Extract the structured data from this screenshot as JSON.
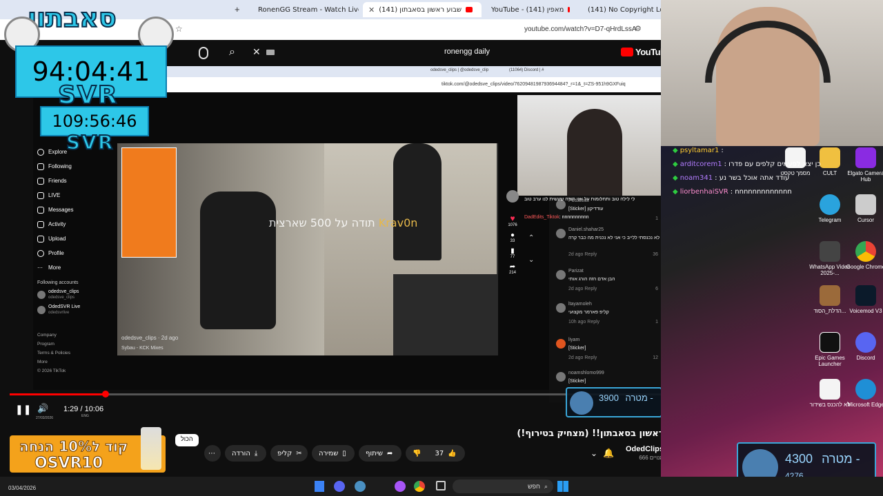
{
  "browser": {
    "tabs": [
      {
        "label": "RonenGG Stream - Watch Live"
      },
      {
        "label": "שבוע ראשון בסאבתון (141)"
      },
      {
        "label": "YouTube - מאפין (141)"
      },
      {
        "label": "(141) No Copyright Lo-Fi Mu"
      }
    ],
    "url": "youtube.com/watch?v=D7-qHrdLssA"
  },
  "youtube": {
    "search_value": "ronengg daily",
    "logo": "YouTube"
  },
  "inner_browser": {
    "tab_label": "odedsve_clips | @odedsve_clip",
    "tab2_label": "(11064) Discord | #",
    "url": "tiktok.com/@odedsve_clips/video/7620948198793694484?_r=1&_t=ZS-951h9GXFuiq"
  },
  "tiktok": {
    "nav": [
      "Explore",
      "Following",
      "Friends",
      "LIVE",
      "Messages",
      "Activity",
      "Upload",
      "Profile",
      "More"
    ],
    "following_title": "Following accounts",
    "accounts": [
      {
        "name": "odedsve_clips",
        "handle": "odedsve_clips"
      },
      {
        "name": "OdedSVR Live",
        "handle": "odedsvrlive"
      }
    ],
    "footer": [
      "Company",
      "Program",
      "Terms & Policies",
      "More",
      "© 2026 TikTok"
    ],
    "video_caption": "odedsve_clips · 2d ago",
    "music": "Sybau - KCK Mixes",
    "overlay_text": "תודה על 500 שארצית",
    "overlay_name": "Krav0n",
    "counts": [
      "1076",
      "33",
      "77",
      "214"
    ],
    "comments": [
      {
        "name": "PostBoss",
        "text": "[Sticker] עודדיקון",
        "meta": "",
        "likes": "1"
      },
      {
        "name": "Daniel.shahar25",
        "text": "אחי כולה היום לא נכנסתי ללייב כי אני לא נכנית מה כבר קרה",
        "meta": "2d ago",
        "likes": "36"
      },
      {
        "name": "Parizat",
        "text": "הבן אדם הזה הורג אותי",
        "meta": "2d ago",
        "likes": "6"
      },
      {
        "name": "ltayamoleh",
        "text": "קליפ פארמר מקצועי",
        "meta": "10h ago",
        "likes": "1"
      },
      {
        "name": "liyam",
        "text": "[Sticker]",
        "meta": "2d ago",
        "likes": "12"
      },
      {
        "name": "noamshlomo999",
        "text": "[Sticker]",
        "meta": "",
        "likes": ""
      }
    ],
    "reply": "Reply"
  },
  "player": {
    "time": "1:29 / 10:06",
    "progress": 0.147,
    "inner_date": "27/03/2026",
    "inner_lang": "ENG"
  },
  "video_meta": {
    "title": "שבוע ראשון בסאבתון!! (מצחיק בטירוף!)",
    "channel": "OdedClips",
    "subscribers": "666 מנויים",
    "likes": "37",
    "share": "שיתוף",
    "save": "שמירה",
    "clip": "קליפ",
    "download": "הורדה",
    "all_chip": "הכול"
  },
  "overlays": {
    "brand_title": "סאבתון",
    "timer1": "94:04:41",
    "timer2": "109:56:46",
    "svr": "SVR",
    "goal_small_value": "3900",
    "goal_small_label": "מטרה -",
    "goal_big_value": "4300",
    "goal_big_label": "מטרה -",
    "goal_big_sub": "4276",
    "promo_line1": "קוד ל10% הנחה",
    "promo_line2": "OSVR10"
  },
  "chat": [
    {
      "user": "psyltamar1",
      "text": ":",
      "color": "#ffcc33"
    },
    {
      "user": "arditcorem1",
      "text": ": כן יצא לפעמים קלפים עם פדרו",
      "color": "#b27cff"
    },
    {
      "user": "noam341",
      "text": ": עודד אתה אוכל בשר נע",
      "color": "#b27cff"
    },
    {
      "user": "liorbenhaiSVR",
      "text": ": nnnnnnnnnnnnn",
      "color": "#ff8fd0"
    },
    {
      "user": "DadEdits_Tiktok",
      "text": ": nnnnnnnnnn",
      "color": "#ff5a5a"
    }
  ],
  "stream_banner": "לי לילה טוב ותחלומות על אני תודה שעשית לנו ערב טוב",
  "desktop_icons": [
    {
      "label": "CULT",
      "color": "#f0c040"
    },
    {
      "label": "Elgato Camera Hub",
      "color": "#8a2be2"
    },
    {
      "label": "Telegram",
      "color": "#2aa3dd"
    },
    {
      "label": "Cursor",
      "color": "#cccccc"
    },
    {
      "label": "WhatsApp Video 2025-...",
      "color": "#444444"
    },
    {
      "label": "Google Chrome",
      "color": "#34a853"
    },
    {
      "label": "הדלת_הסוד...",
      "color": "#9b6a3a"
    },
    {
      "label": "Voicemod V3",
      "color": "#0b1a2a"
    },
    {
      "label": "Epic Games Launcher",
      "color": "#111111"
    },
    {
      "label": "Discord",
      "color": "#5865f2"
    },
    {
      "label": "לא להכנס בשידור",
      "color": "#f4f4f4"
    },
    {
      "label": "Microsoft Edge",
      "color": "#1f8fd6"
    },
    {
      "label": "מסמך טקסט",
      "color": "#f4f4f4"
    }
  ],
  "taskbar": {
    "search_label": "חפש",
    "date": "03/04/2026"
  },
  "colors": {
    "yt_red": "#ff0000",
    "svr_cyan": "#2dc7e8",
    "promo_orange": "#f4a21b"
  }
}
